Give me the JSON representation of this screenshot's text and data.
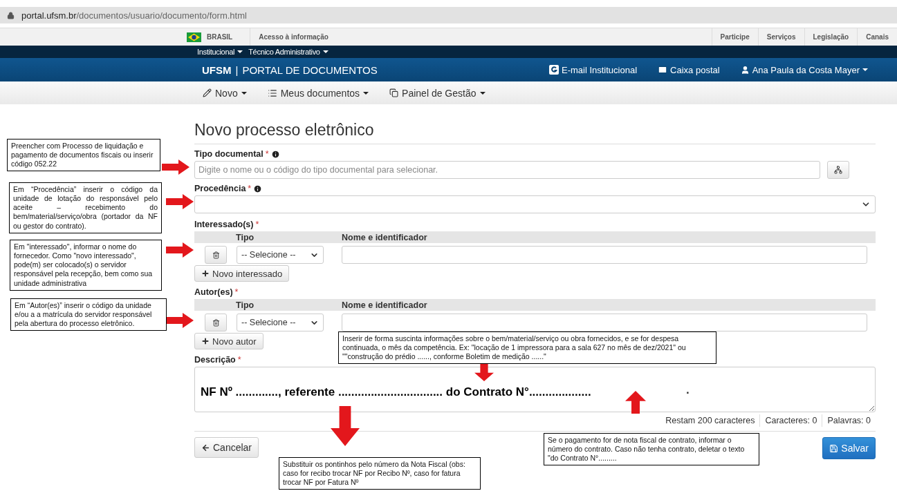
{
  "browser": {
    "host": "portal.ufsm.br",
    "path": "/documentos/usuario/documento/form.html"
  },
  "gov_bar": {
    "country": "BRASIL",
    "access": "Acesso à informação",
    "links": [
      "Participe",
      "Serviços",
      "Legislação",
      "Canais"
    ]
  },
  "top_nav": [
    "Institucional",
    "Técnico Administrativo"
  ],
  "header": {
    "brand": "UFSM",
    "separator": "|",
    "title": "PORTAL DE DOCUMENTOS",
    "links": [
      {
        "kind": "email",
        "label": "E-mail Institucional",
        "dropdown": false
      },
      {
        "kind": "mail",
        "label": "Caixa postal",
        "dropdown": false
      },
      {
        "kind": "user",
        "label": "Ana Paula da Costa Mayer",
        "dropdown": true
      }
    ]
  },
  "menu": [
    {
      "kind": "pencil",
      "label": "Novo"
    },
    {
      "kind": "list",
      "label": "Meus documentos"
    },
    {
      "kind": "copy",
      "label": "Painel de Gestão"
    }
  ],
  "form": {
    "title": "Novo processo eletrônico",
    "tipo": {
      "label": "Tipo documental",
      "required_mark": "*",
      "placeholder": "Digite o nome ou o código do tipo documental para selecionar."
    },
    "procedencia": {
      "label": "Procedência",
      "required_mark": "*"
    },
    "groups": [
      {
        "label": "Interessado(s)",
        "required_mark": "*",
        "columns": [
          "Tipo",
          "Nome e identificador"
        ],
        "select": "-- Selecione --",
        "add_button": "Novo interessado"
      },
      {
        "label": "Autor(es)",
        "required_mark": "*",
        "columns": [
          "Tipo",
          "Nome e identificador"
        ],
        "select": "-- Selecione --",
        "add_button": "Novo autor"
      }
    ],
    "descricao": {
      "label": "Descrição",
      "required_mark": "*",
      "value": "NF Nº ............., referente ................................ do Contrato N°...................",
      "stray_mark": "."
    },
    "counters": [
      "Restam 200 caracteres",
      "Caracteres: 0",
      "Palavras: 0"
    ],
    "cancel": "Cancelar",
    "save": "Salvar"
  },
  "annotations": [
    {
      "text": "Preencher com Processo de liquidação e pagamento de documentos fiscais ou inserir código 052.22",
      "justify": false
    },
    {
      "text": "Em “Procedência” inserir o código da unidade de lotação do responsável pelo aceite – recebimento do bem/material/serviço/obra (portador da NF ou gestor do contrato).",
      "justify": true
    },
    {
      "text": "Em \"interessado\", informar o nome do fornecedor. Como \"novo interessado\", pode(m) ser colocado(s) o servidor responsável pela recepção, bem como sua unidade administrativa",
      "justify": false
    },
    {
      "text": "Em “Autor(es)” inserir o código da unidade e/ou a a matrícula do servidor responsável pela abertura do processo eletrônico.",
      "justify": false
    },
    {
      "text": "Inserir de forma suscinta informações sobre o bem/material/serviço ou obra fornecidos, e se for despesa continuada, o mês da competência. Ex: \"locação de 1 impressora para a sala 627 no mês de dez/2021\" ou \"\"construção do prédio ......, conforme Boletim de medição ......\"",
      "justify": false
    },
    {
      "text": "Substituir os pontinhos pelo número da Nota Fiscal (obs: caso for recibo trocar NF por Recibo Nº, caso for fatura trocar NF por Fatura Nº",
      "justify": false
    },
    {
      "text": "Se o pagamento for de nota fiscal de contrato, informar o número do contrato. Caso não tenha contrato, deletar o texto \"do Contrato N°.........",
      "justify": false
    }
  ]
}
